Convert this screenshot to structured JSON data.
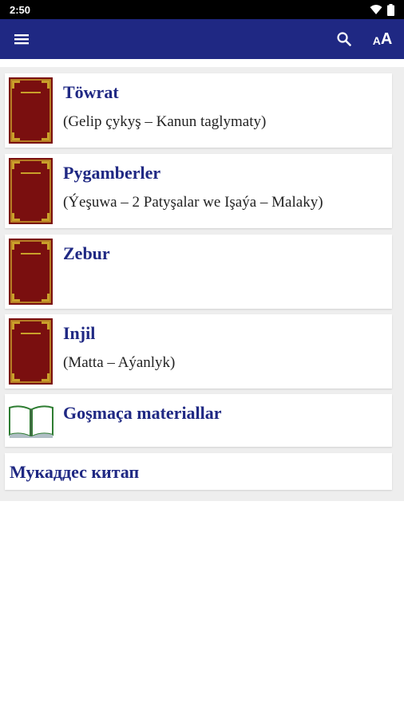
{
  "status_bar": {
    "time": "2:50",
    "icons": [
      "wifi-icon",
      "battery-icon"
    ]
  },
  "app_bar": {
    "menu_icon": "hamburger-menu-icon",
    "search_icon": "search-icon",
    "font_size_icon": "text-size-icon",
    "font_size_label": "AA",
    "background": "#1f2883"
  },
  "colors": {
    "accent": "#1f2883",
    "cover": "#7a0f0f",
    "cover_border": "#c9a02a",
    "page_bg": "#eeeeee"
  },
  "books": [
    {
      "title": "Töwrat",
      "subtitle": "(Gelip çykyş – Kanun taglymaty)",
      "icon": "book-cover-icon"
    },
    {
      "title": "Pygamberler",
      "subtitle": "(Ýeşuwa – 2 Patyşalar we Işaýa – Malaky)",
      "icon": "book-cover-icon"
    },
    {
      "title": "Zebur",
      "subtitle": "",
      "icon": "book-cover-icon"
    },
    {
      "title": "Injil",
      "subtitle": "(Matta – Aýanlyk)",
      "icon": "book-cover-icon"
    }
  ],
  "extra_materials": {
    "title": "Goşmaça materiallar",
    "icon": "open-book-icon"
  },
  "cyrillic_link": {
    "title": "Мукаддес китап"
  }
}
